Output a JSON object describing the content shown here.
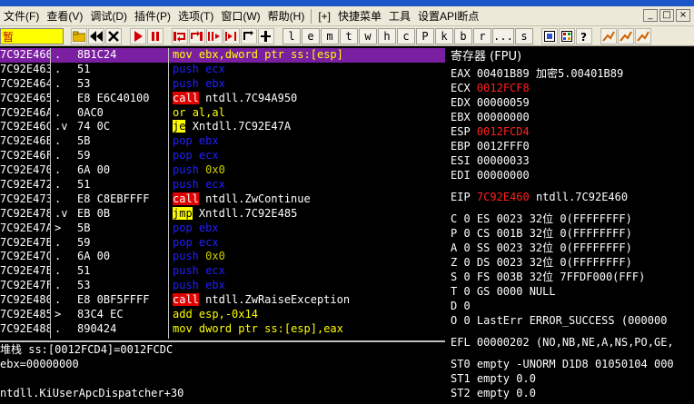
{
  "menu": [
    {
      "id": "file",
      "label": "文件(F)"
    },
    {
      "id": "view",
      "label": "查看(V)"
    },
    {
      "id": "debug",
      "label": "调试(D)"
    },
    {
      "id": "plugins",
      "label": "插件(P)"
    },
    {
      "id": "options",
      "label": "选项(T)"
    },
    {
      "id": "window",
      "label": "窗口(W)"
    },
    {
      "id": "help",
      "label": "帮助(H)"
    },
    {
      "id": "plus",
      "label": "[+]"
    },
    {
      "id": "quickmenu",
      "label": "快捷菜单"
    },
    {
      "id": "tools",
      "label": "工具"
    },
    {
      "id": "apibreak",
      "label": "设置API断点"
    }
  ],
  "window_controls": [
    "_",
    "□",
    "×"
  ],
  "toolbar": {
    "status": "暂",
    "letters": [
      "l",
      "e",
      "m",
      "t",
      "w",
      "h",
      "c",
      "P",
      "k",
      "b",
      "r",
      "...",
      "s"
    ]
  },
  "disasm": [
    {
      "addr": "7C92E460",
      "mark": ".",
      "hex": "8B1C24",
      "kind": "mov",
      "mn": "mov",
      "ops": "ebx,dword ptr ss:[esp]",
      "selected": true
    },
    {
      "addr": "7C92E463",
      "mark": ".",
      "hex": "51",
      "kind": "push",
      "mn": "push",
      "ops": "ecx"
    },
    {
      "addr": "7C92E464",
      "mark": ".",
      "hex": "53",
      "kind": "push",
      "mn": "push",
      "ops": "ebx"
    },
    {
      "addr": "7C92E465",
      "mark": ".",
      "hex": "E8 E6C40100",
      "kind": "call",
      "mn": "call",
      "ops": "ntdll.7C94A950"
    },
    {
      "addr": "7C92E46A",
      "mark": ".",
      "hex": "0AC0",
      "kind": "gen",
      "mn": "or",
      "ops": "al,al"
    },
    {
      "addr": "7C92E46C",
      "mark": ".v",
      "hex": "74 0C",
      "kind": "jmp",
      "mn": "je",
      "ops": "Xntdll.7C92E47A"
    },
    {
      "addr": "7C92E46E",
      "mark": ".",
      "hex": "5B",
      "kind": "pop",
      "mn": "pop",
      "ops": "ebx"
    },
    {
      "addr": "7C92E46F",
      "mark": ".",
      "hex": "59",
      "kind": "pop",
      "mn": "pop",
      "ops": "ecx"
    },
    {
      "addr": "7C92E470",
      "mark": ".",
      "hex": "6A 00",
      "kind": "push",
      "mn": "push",
      "ops": "0x0"
    },
    {
      "addr": "7C92E472",
      "mark": ".",
      "hex": "51",
      "kind": "push",
      "mn": "push",
      "ops": "ecx"
    },
    {
      "addr": "7C92E473",
      "mark": ".",
      "hex": "E8 C8EBFFFF",
      "kind": "call",
      "mn": "call",
      "ops": "ntdll.ZwContinue"
    },
    {
      "addr": "7C92E478",
      "mark": ".v",
      "hex": "EB 0B",
      "kind": "jmp",
      "mn": "jmp",
      "ops": "Xntdll.7C92E485"
    },
    {
      "addr": "7C92E47A",
      "mark": ">",
      "hex": "5B",
      "kind": "pop",
      "mn": "pop",
      "ops": "ebx"
    },
    {
      "addr": "7C92E47B",
      "mark": ".",
      "hex": "59",
      "kind": "pop",
      "mn": "pop",
      "ops": "ecx"
    },
    {
      "addr": "7C92E47C",
      "mark": ".",
      "hex": "6A 00",
      "kind": "push",
      "mn": "push",
      "ops": "0x0"
    },
    {
      "addr": "7C92E47E",
      "mark": ".",
      "hex": "51",
      "kind": "push",
      "mn": "push",
      "ops": "ecx"
    },
    {
      "addr": "7C92E47F",
      "mark": ".",
      "hex": "53",
      "kind": "push",
      "mn": "push",
      "ops": "ebx"
    },
    {
      "addr": "7C92E480",
      "mark": ".",
      "hex": "E8 0BF5FFFF",
      "kind": "call",
      "mn": "call",
      "ops": "ntdll.ZwRaiseException"
    },
    {
      "addr": "7C92E485",
      "mark": ">",
      "hex": "83C4 EC",
      "kind": "gen",
      "mn": "add",
      "ops": "esp,-0x14"
    },
    {
      "addr": "7C92E488",
      "mark": ".",
      "hex": "890424",
      "kind": "mov",
      "mn": "mov",
      "ops": "dword ptr ss:[esp],eax"
    }
  ],
  "info": [
    "堆栈 ss:[0012FCD4]=0012FCDC",
    "ebx=00000000",
    "",
    "ntdll.KiUserApcDispatcher+30"
  ],
  "registers": {
    "title": "寄存器 (FPU)",
    "gpr": [
      {
        "name": "EAX",
        "value": "00401B89",
        "note": "加密5.00401B89",
        "changed": false
      },
      {
        "name": "ECX",
        "value": "0012FCF8",
        "note": "",
        "changed": true
      },
      {
        "name": "EDX",
        "value": "00000059",
        "note": "",
        "changed": false
      },
      {
        "name": "EBX",
        "value": "00000000",
        "note": "",
        "changed": false
      },
      {
        "name": "ESP",
        "value": "0012FCD4",
        "note": "",
        "changed": true
      },
      {
        "name": "EBP",
        "value": "0012FFF0",
        "note": "",
        "changed": false
      },
      {
        "name": "ESI",
        "value": "00000033",
        "note": "",
        "changed": false
      },
      {
        "name": "EDI",
        "value": "00000000",
        "note": "",
        "changed": false
      }
    ],
    "eip": {
      "name": "EIP",
      "value": "7C92E460",
      "note": "ntdll.7C92E460"
    },
    "flags": [
      "C 0  ES 0023 32位 0(FFFFFFFF)",
      "P 0  CS 001B 32位 0(FFFFFFFF)",
      "A 0  SS 0023 32位 0(FFFFFFFF)",
      "Z 0  DS 0023 32位 0(FFFFFFFF)",
      "S 0  FS 003B 32位 7FFDF000(FFF)",
      "T 0  GS 0000 NULL",
      "D 0",
      "O 0  LastErr ERROR_SUCCESS (000000"
    ],
    "efl": "EFL 00000202 (NO,NB,NE,A,NS,PO,GE,",
    "fpu": [
      "ST0 empty -UNORM D1D8 01050104 000",
      "ST1 empty 0.0",
      "ST2 empty 0.0"
    ]
  },
  "colors": {
    "background": "#000000",
    "selection": "#7b1fa2",
    "call_bg": "#e00000",
    "jump_bg": "#ffff00",
    "push_pop": "#2020ff",
    "changed_reg": "#ff2020"
  }
}
